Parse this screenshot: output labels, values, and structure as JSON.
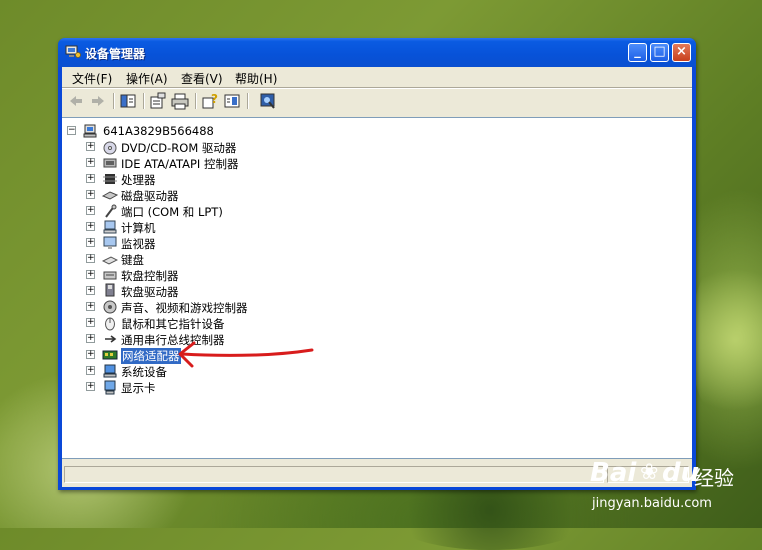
{
  "window": {
    "title": "设备管理器",
    "buttons": {
      "minimize": "_",
      "maximize": "□",
      "close": "×"
    }
  },
  "menu": [
    {
      "label": "文件(F)"
    },
    {
      "label": "操作(A)"
    },
    {
      "label": "查看(V)"
    },
    {
      "label": "帮助(H)"
    }
  ],
  "toolbar": {
    "icons": [
      "back-arrow-icon",
      "forward-arrow-icon",
      "console-tree-icon",
      "properties-icon",
      "print-icon",
      "help-icon",
      "view-icon",
      "scan-hardware-icon"
    ]
  },
  "tree": {
    "root": {
      "label": "641A3829B566488",
      "expander": "−"
    },
    "expander_collapsed": "+",
    "items": [
      {
        "label": "DVD/CD-ROM 驱动器",
        "icon": "cdrom-icon"
      },
      {
        "label": "IDE ATA/ATAPI 控制器",
        "icon": "ide-controller-icon"
      },
      {
        "label": "处理器",
        "icon": "processor-icon"
      },
      {
        "label": "磁盘驱动器",
        "icon": "disk-drive-icon"
      },
      {
        "label": "端口 (COM 和 LPT)",
        "icon": "port-icon"
      },
      {
        "label": "计算机",
        "icon": "computer-icon"
      },
      {
        "label": "监视器",
        "icon": "monitor-icon"
      },
      {
        "label": "键盘",
        "icon": "keyboard-icon"
      },
      {
        "label": "软盘控制器",
        "icon": "floppy-controller-icon"
      },
      {
        "label": "软盘驱动器",
        "icon": "floppy-drive-icon"
      },
      {
        "label": "声音、视频和游戏控制器",
        "icon": "sound-icon"
      },
      {
        "label": "鼠标和其它指针设备",
        "icon": "mouse-icon"
      },
      {
        "label": "通用串行总线控制器",
        "icon": "usb-icon"
      },
      {
        "label": "网络适配器",
        "icon": "network-adapter-icon",
        "selected": true
      },
      {
        "label": "系统设备",
        "icon": "system-device-icon"
      },
      {
        "label": "显示卡",
        "icon": "display-adapter-icon"
      }
    ]
  },
  "colors": {
    "selection": "#316ac5",
    "annotation_arrow": "#d81c1c",
    "titlebar": "#0a52d8"
  },
  "watermark": {
    "brand": "Bai",
    "brand_suffix": "du",
    "product": "经验",
    "url": "jingyan.baidu.com"
  }
}
